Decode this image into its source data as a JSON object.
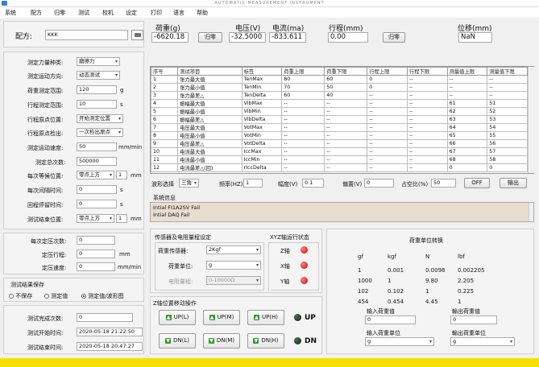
{
  "app": {
    "title": "AUTOMATIC MEASUREMENT INSTRUMENT"
  },
  "menu": [
    "系统",
    "配方",
    "归零",
    "测试",
    "校机",
    "设定",
    "打印",
    "语言",
    "帮助"
  ],
  "recipe": {
    "label": "配方:",
    "value": "KKK"
  },
  "readouts": {
    "load": {
      "label": "荷重(g)",
      "value": "-6620.18",
      "button": "归零"
    },
    "voltage": {
      "label": "电压(V)",
      "value": "-32.5000"
    },
    "current": {
      "label": "电流(ma)",
      "value": "-833.611"
    },
    "stroke": {
      "label": "行程(mm)",
      "value": "0.00",
      "button": "归零"
    },
    "displacement": {
      "label": "位移(mm)",
      "value": "NaN"
    }
  },
  "settings": {
    "force_type": {
      "label": "测定力量种类:",
      "value": "磨擦力"
    },
    "direction": {
      "label": "测定运动方向:",
      "value": "动态测试"
    },
    "load_range": {
      "label": "荷重测定范围:",
      "value": "120",
      "unit": "g"
    },
    "stroke_range": {
      "label": "行程测定范围:",
      "value": "10",
      "unit": "s"
    },
    "origin": {
      "label": "行程原点位置:",
      "value": "开始测定位置"
    },
    "origin_detect": {
      "label": "行程原点检出:",
      "value": "一次检出原点"
    },
    "speed": {
      "label": "测定运动速度:",
      "value": "50",
      "unit": "mm/min"
    },
    "total_count": {
      "label": "测定总次数:",
      "value": "500000"
    },
    "wait_pos": {
      "label": "每次等候位置:",
      "value": "零点上方",
      "spin": "1",
      "unit": "mm"
    },
    "interval": {
      "label": "每次间隔时间:",
      "value": "0",
      "unit": "s"
    },
    "return_wait": {
      "label": "回程停留时间:",
      "value": "0",
      "unit": "s"
    },
    "end_pos": {
      "label": "测试结束位置:",
      "value": "零点上方",
      "spin": "1",
      "unit": "mm"
    }
  },
  "pressure": {
    "count": {
      "label": "每次定压次数:",
      "value": "0"
    },
    "stroke": {
      "label": "定压行程:",
      "value": "0",
      "unit": "mm"
    },
    "speed": {
      "label": "定压速度:",
      "value": "0",
      "unit": "mm/min"
    }
  },
  "save": {
    "title": "测试结果保存",
    "options": [
      "不保存",
      "测定值",
      "测定值/波形图"
    ],
    "selected": 2
  },
  "status_times": {
    "done": {
      "label": "测试完成次数:",
      "value": "0"
    },
    "start": {
      "label": "测试开始时间:",
      "value": "2020-05-18 21:22:50"
    },
    "end": {
      "label": "测试结束时间:",
      "value": "2020-05-18 20:47:27"
    }
  },
  "table": {
    "columns": [
      "序号",
      "测试项目",
      "标签",
      "荷重上限",
      "荷重下限",
      "行程上限",
      "行程下限",
      "测量值上限",
      "测量值下限"
    ],
    "rows": [
      [
        "1",
        "张力最大值",
        "TenMax",
        "80",
        "60",
        "0",
        "--",
        "--",
        "--"
      ],
      [
        "2",
        "张力最小值",
        "TenMin",
        "70",
        "50",
        "0",
        "--",
        "--",
        "--"
      ],
      [
        "3",
        "张力最差△",
        "TenDelta",
        "60",
        "40",
        "--",
        "--",
        "--",
        "--"
      ],
      [
        "4",
        "振幅最大值",
        "VibMax",
        "--",
        "--",
        "--",
        "--",
        "61",
        "51"
      ],
      [
        "5",
        "振幅最小值",
        "VibMin",
        "--",
        "--",
        "--",
        "--",
        "62",
        "52"
      ],
      [
        "6",
        "振幅最差△",
        "VibDelta",
        "--",
        "--",
        "--",
        "--",
        "63",
        "53"
      ],
      [
        "7",
        "电压最大值",
        "VotMax",
        "--",
        "--",
        "--",
        "--",
        "64",
        "54"
      ],
      [
        "8",
        "电压最小值",
        "VotMin",
        "--",
        "--",
        "--",
        "--",
        "65",
        "55"
      ],
      [
        "9",
        "电压最差△",
        "VotDelta",
        "--",
        "--",
        "--",
        "--",
        "66",
        "56"
      ],
      [
        "10",
        "电流最大值",
        "IccMax",
        "--",
        "--",
        "--",
        "--",
        "67",
        "57"
      ],
      [
        "11",
        "电流最小值",
        "IccMin",
        "--",
        "--",
        "--",
        "--",
        "68",
        "58"
      ],
      [
        "12",
        "电流最差△(回)",
        "rIccDelta",
        "--",
        "--",
        "--",
        "--",
        "0",
        "0"
      ]
    ]
  },
  "filter": {
    "waveform": {
      "label": "波形选择",
      "value": "三角"
    },
    "freq": {
      "label": "频率(HZ)",
      "value": "1"
    },
    "amp": {
      "label": "幅度(V)",
      "value": "0.1"
    },
    "offset": {
      "label": "偏置(V)",
      "value": "0"
    },
    "duty": {
      "label": "占空比(%)",
      "value": "50"
    },
    "off": "OFF",
    "output": "输出"
  },
  "sysinfo": {
    "title": "系统信息",
    "lines": [
      "Intial FI1A2SV Fail",
      "Intial DAQ Fail"
    ]
  },
  "sensor": {
    "title": "传感器及电阻量程设定",
    "load_sensor": {
      "label": "荷重传感器:",
      "value": "2Kgf"
    },
    "load_unit": {
      "label": "荷重单位:",
      "value": "g"
    },
    "resistance": {
      "label": "电阻量程:",
      "value": "0-10000Ω"
    }
  },
  "xyz": {
    "title": "XYZ轴运行状态",
    "axes": [
      "Z轴",
      "X轴",
      "Y轴"
    ]
  },
  "zmove": {
    "title": "Z轴位置移动操作",
    "up": [
      "UP(L)",
      "UP(M)",
      "UP(H)"
    ],
    "dn": [
      "DN(L)",
      "DN(M)",
      "DN(H)"
    ],
    "up_label": "UP",
    "dn_label": "DN"
  },
  "conversion": {
    "title": "荷重单位转换",
    "headers": [
      "gf",
      "kgf",
      "N",
      "lbf"
    ],
    "rows": [
      [
        "1",
        "0.001",
        "0.0098",
        "0.002205"
      ],
      [
        "1000",
        "1",
        "9.80",
        "2.205"
      ],
      [
        "102",
        "0.102",
        "1",
        "0.225"
      ],
      [
        "454",
        "0.454",
        "4.45",
        "1"
      ]
    ],
    "in_value": {
      "label": "输入荷重值",
      "value": "0"
    },
    "out_value": {
      "label": "輸出荷重值",
      "value": "0"
    },
    "in_unit": {
      "label": "输入荷重单位",
      "value": "g"
    },
    "out_unit": {
      "label": "輸出荷重单位",
      "value": "g"
    }
  },
  "colors": {
    "status_bar": "#f5e000",
    "led_on": "#d00000",
    "led_dark": "#0e260e"
  }
}
